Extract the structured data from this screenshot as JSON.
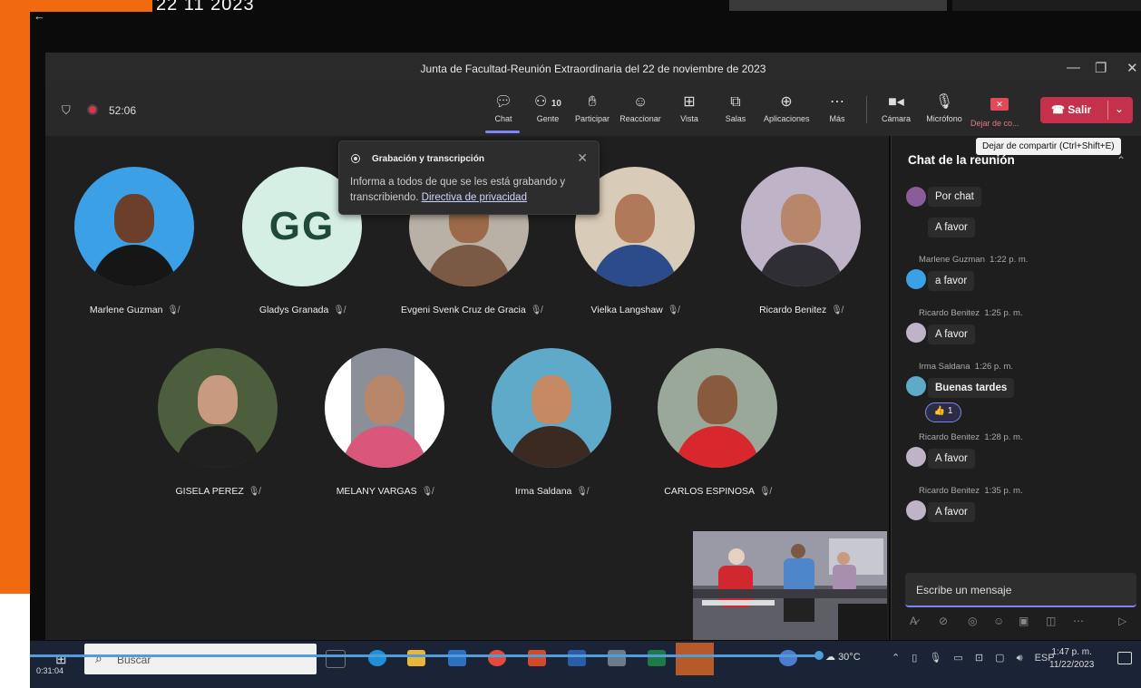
{
  "outer": {
    "date": "22 11 2023",
    "back_symbol": "←"
  },
  "window": {
    "title": "Junta de Facultad-Reunión Extraordinaria del 22 de noviembre de 2023"
  },
  "meeting": {
    "timer": "52:06"
  },
  "toolbar": {
    "chat": "Chat",
    "people": "Gente",
    "people_count": "10",
    "raise": "Participar",
    "react": "Reaccionar",
    "view": "Vista",
    "rooms": "Salas",
    "apps": "Aplicaciones",
    "more": "Más",
    "camera": "Cámara",
    "mic": "Micrófono",
    "share": "Dejar de co...",
    "leave": "Salir"
  },
  "tooltip": "Dejar de compartir (Ctrl+Shift+E)",
  "recording_popup": {
    "title": "Grabación y transcripción",
    "body": "Informa a todos de que se les está grabando y transcribiendo.",
    "link": "Directiva de privacidad"
  },
  "participants_row1": [
    {
      "name": "Marlene Guzman"
    },
    {
      "name": "Gladys Granada",
      "initials": "GG"
    },
    {
      "name": "Evgeni Svenk Cruz de Gracia"
    },
    {
      "name": "Vielka Langshaw"
    },
    {
      "name": "Ricardo Benitez"
    }
  ],
  "participants_row2": [
    {
      "name": "GISELA PEREZ"
    },
    {
      "name": "MELANY VARGAS"
    },
    {
      "name": "Irma Saldana"
    },
    {
      "name": "CARLOS ESPINOSA"
    }
  ],
  "chat": {
    "title": "Chat de la reunión",
    "messages": [
      {
        "text": "Por chat"
      },
      {
        "text": "A favor"
      },
      {
        "author": "Marlene Guzman",
        "time": "1:22 p. m.",
        "text": "a favor"
      },
      {
        "author": "Ricardo Benitez",
        "time": "1:25 p. m.",
        "text": "A favor"
      },
      {
        "author": "Irma Saldana",
        "time": "1:26 p. m.",
        "text": "Buenas tardes",
        "reaction": "👍 1"
      },
      {
        "author": "Ricardo Benitez",
        "time": "1:28 p. m.",
        "text": "A favor"
      },
      {
        "author": "Ricardo Benitez",
        "time": "1:35 p. m.",
        "text": "A favor"
      }
    ],
    "input_placeholder": "Escribe un mensaje"
  },
  "taskbar": {
    "search": "Buscar",
    "weather": "30°C",
    "lang": "ESP",
    "time": "1:47 p. m.",
    "date": "11/22/2023"
  },
  "video": {
    "elapsed": "0:31:04"
  },
  "colors": {
    "accent": "#7f85f5",
    "leave": "#c4314b",
    "orange": "#f26a10"
  }
}
